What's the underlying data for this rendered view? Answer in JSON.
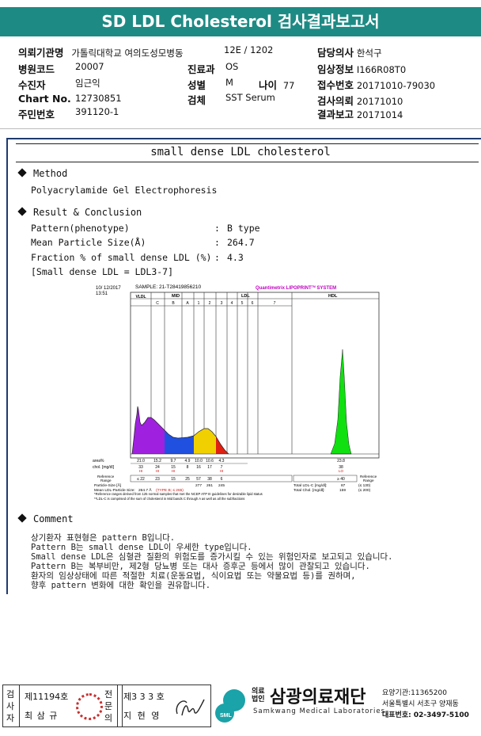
{
  "header": {
    "title": "SD LDL Cholesterol 검사결과보고서"
  },
  "info": {
    "institution_label": "의뢰기관명",
    "institution": "가톨릭대학교 여의도성모병동",
    "ward": "12E / 1202",
    "doctor_label": "담당의사",
    "doctor": "한석구",
    "hospital_code_label": "병원코드",
    "hospital_code": "20007",
    "department_label": "진료과",
    "department": "OS",
    "clinical_label": "임상정보",
    "clinical": "I166R08T0",
    "patient_label": "수진자",
    "patient": "임근익",
    "sex_label": "성별",
    "sex": "M",
    "age_label": "나이",
    "age": "77",
    "receipt_label": "접수번호",
    "receipt": "20171010-79030",
    "chart_label": "Chart No.",
    "chart": "12730851",
    "specimen_label": "검체",
    "specimen": "SST Serum",
    "request_label": "검사의뢰",
    "request": "20171010",
    "id_label": "주민번호",
    "id": "391120-1",
    "report_label": "결과보고",
    "report": "20171014"
  },
  "section_title": "small dense LDL cholesterol",
  "method": {
    "heading": "Method",
    "text": "Polyacrylamide Gel Electrophoresis"
  },
  "result": {
    "heading": "Result & Conclusion",
    "rows": [
      {
        "label": "Pattern(phenotype)",
        "value": "B type"
      },
      {
        "label": "Mean Particle Size(Å)",
        "value": "264.7"
      },
      {
        "label": "Fraction % of small dense LDL (%)",
        "value": "4.3"
      }
    ],
    "colon": ":",
    "note": "[Small dense LDL = LDL3-7]"
  },
  "chart_data": {
    "type": "area",
    "stamp_date": "10/ 12/2017",
    "stamp_time": "13:51",
    "sample": "SAMPLE:  21-T28419856210",
    "brand": "Quantimetrix LIPOPRINT",
    "brand_tm": "TM",
    "brand_suffix": " SYSTEM",
    "bands": [
      "VLDL",
      "C",
      "B",
      "A",
      "1",
      "2",
      "3",
      "4",
      "5",
      "6",
      "7",
      "HDL"
    ],
    "group_labels": {
      "mid": "MID",
      "ldl": "LDL",
      "hdl": "HDL"
    },
    "rows": {
      "area_label": "area%",
      "area": [
        "21.0",
        "15.2",
        "9.7",
        "4.9",
        "10.0",
        "10.6",
        "4.3",
        "",
        "",
        "",
        "",
        "23.8"
      ],
      "chol_label": "chol. [mg/dl]",
      "chol": [
        "33",
        "24",
        "15",
        "8",
        "16",
        "17",
        "7",
        "",
        "",
        "",
        "",
        "38"
      ],
      "flag": [
        "HI",
        "HI",
        "HI",
        "",
        "",
        "",
        "HI",
        "",
        "",
        "",
        "",
        "LO"
      ],
      "ref_label": "Reference Range",
      "ref": [
        "≤ 22",
        "23",
        "15",
        "25",
        "57",
        "38",
        "6",
        "",
        "",
        "",
        "",
        "≥ 40"
      ],
      "ref_right": "Reference Range"
    },
    "particle_label": "Particle-Size [Å]",
    "particle_values": [
      "277",
      "261",
      "245"
    ],
    "mean_label": "Mean LDL-Particle Size:",
    "mean_value": "264.7 Å",
    "mean_type": "(TYPE B; ≤ 265)",
    "total_ldl_label": "Total LDL-C [mg/dl]:",
    "total_ldl_value": "87",
    "total_ldl_ref": "(≤ 130)",
    "total_chol_label": "Total Chol. [mg/dl]:",
    "total_chol_value": "159",
    "total_chol_ref": "(≤ 200)",
    "footnote1": "*Reference ranges derived from 125 normal samples that met the NCEP ATP III guidelines for desirable lipid status",
    "footnote2": "**LDL-C is comprised of the sum of cholesterol in Mid bands C through A as well as all the subfractions",
    "colors": {
      "vldl": "#a020e0",
      "mid": "#2050e0",
      "ldl": "#f0d000",
      "ldl_red": "#e02010",
      "hdl": "#10e010",
      "brand": "#c000c0"
    }
  },
  "comment": {
    "heading": "Comment",
    "lines": [
      "상기환자 표현형은 pattern B입니다.",
      "Pattern B는 small dense LDL이 우세한 type입니다.",
      "Small dense LDL은 심혈관 질환의 위험도를 증가시킬 수 있는 위험인자로 보고되고 있습니다.",
      "Pattern B는 복부비만, 제2형 당뇨병 또는 대사 증후군 등에서 많이 관찰되고 있습니다.",
      "환자의 임상상태에 따른 적절한 치료(운동요법, 식이요법 또는 약물요법 등)를 권하며,",
      "향후 pattern 변화에 대한 확인을 권유합니다."
    ]
  },
  "footer": {
    "checker_label": "검사자",
    "checker_no": "제11194호",
    "checker_name": "최 삼 규",
    "specialist_label": "전문의",
    "specialist_no": "제3 3 3 호",
    "specialist_name": "지 현 영",
    "corp_small1": "의료",
    "corp_small2": "법인",
    "corp_name": "삼광의료재단",
    "corp_en": "Samkwang Medical Laboratories",
    "logo_text": "SML",
    "code_line": "요양기관:11365200",
    "address": "서울특별시 서초구 양재동",
    "phone": "대표번호: 02-3497-5100"
  }
}
